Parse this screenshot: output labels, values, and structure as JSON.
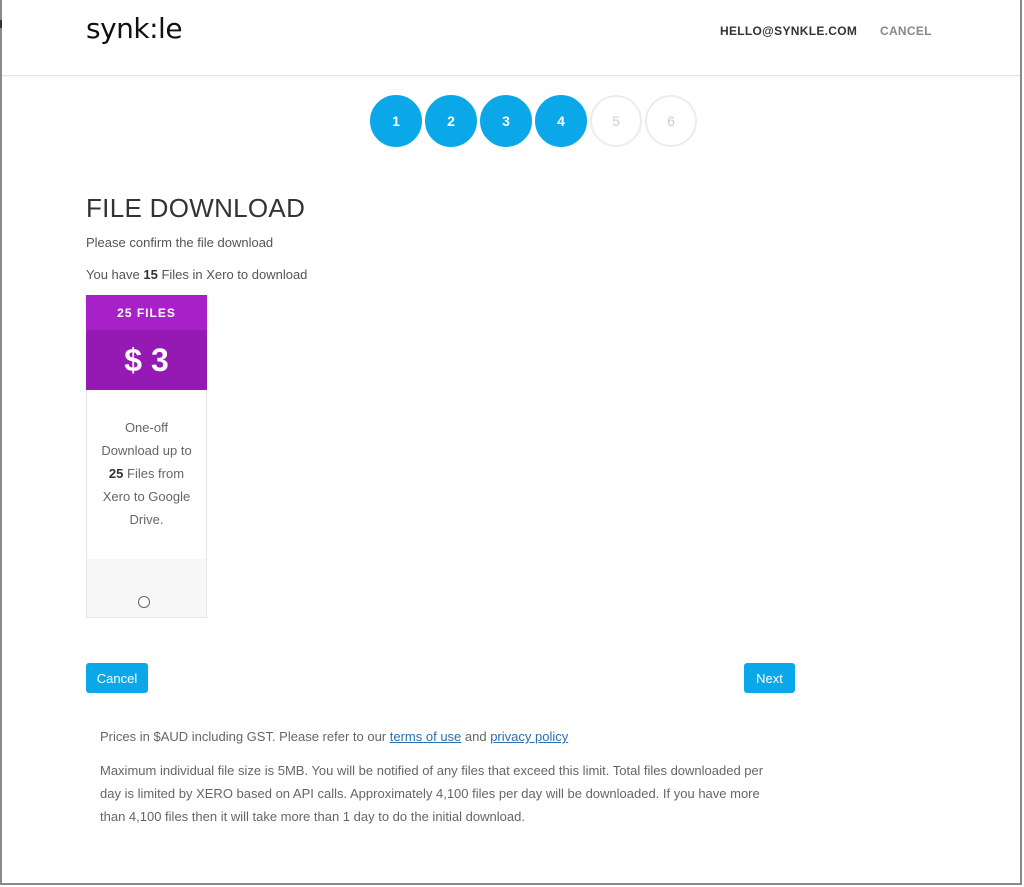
{
  "header": {
    "logo_text": "synk:le",
    "email_link": "HELLO@SYNKLE.COM",
    "cancel_link": "CANCEL"
  },
  "steps": {
    "items": [
      "1",
      "2",
      "3",
      "4",
      "5",
      "6"
    ],
    "current_step": 4,
    "total_steps": 6
  },
  "page": {
    "title": "FILE DOWNLOAD",
    "subtitle": "Please confirm the file download",
    "files_prefix": "You have ",
    "files_count": "15",
    "files_suffix": " Files in Xero to download"
  },
  "plan": {
    "name": "25 FILES",
    "price": "$ 3",
    "desc_part1": "One-off Download up to ",
    "desc_count": "25",
    "desc_part2": " Files from Xero to Google Drive.",
    "selected": false
  },
  "buttons": {
    "cancel": "Cancel",
    "next": "Next"
  },
  "footer": {
    "prices_text": "Prices in $AUD including GST. Please refer to our ",
    "terms_link": "terms of use",
    "and_text": " and ",
    "privacy_link": "privacy policy",
    "limits_text": "Maximum individual file size is 5MB. You will be notified of any files that exceed this limit. Total files downloaded per day is limited by XERO based on API calls. Approximately 4,100 files per day will be downloaded. If you have more than 4,100 files then it will take more than 1 day to do the initial download."
  },
  "colors": {
    "accent": "#0aa8e8",
    "plan_header": "#a820c8",
    "plan_price_bg": "#951ab4"
  }
}
